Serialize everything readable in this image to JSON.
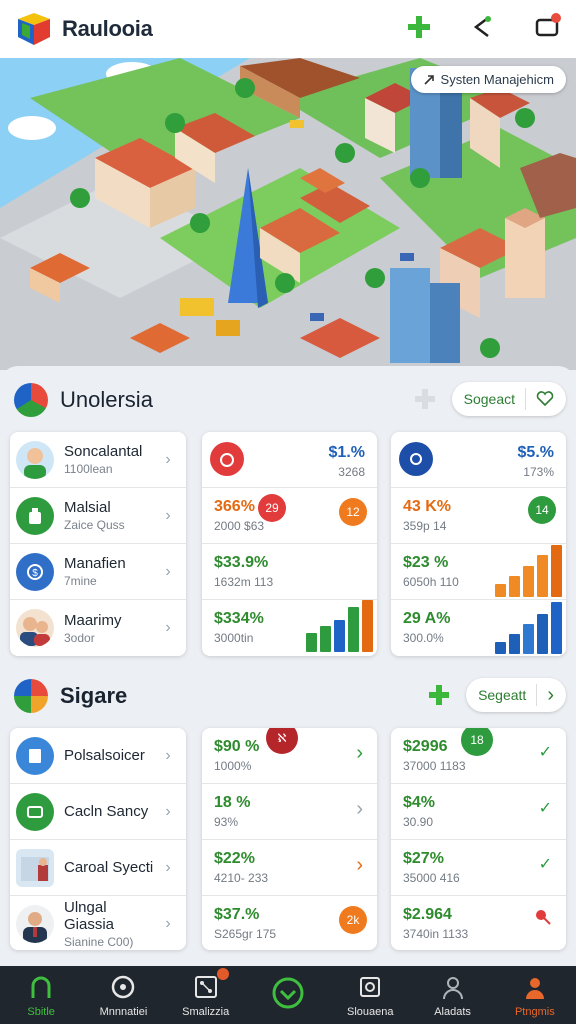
{
  "app": {
    "title": "Raulooia"
  },
  "hero": {
    "chip_label": "Systen Manajehicm"
  },
  "section1": {
    "title": "Unolersia",
    "action_label": "Sogeact",
    "list": [
      {
        "title": "Soncalantal",
        "sub": "1100lean"
      },
      {
        "title": "Malsial",
        "sub": "Zaice Quss"
      },
      {
        "title": "Manafien",
        "sub": "7mine"
      },
      {
        "title": "Maarimy",
        "sub": "3odor"
      }
    ],
    "col2": {
      "head_value": "$1.%",
      "head_sub": "3268",
      "rows": [
        {
          "value": "366%",
          "sub": "2000 $63",
          "badge": "29"
        },
        {
          "value": "$33.9%",
          "sub": "1632m 113"
        },
        {
          "value": "$334%",
          "sub": "3000tin"
        }
      ],
      "head_badge_extra": "12",
      "bars": [
        20,
        28,
        34,
        48,
        56
      ]
    },
    "col3": {
      "head_value": "$5.%",
      "head_sub": "173%",
      "rows": [
        {
          "value": "43 K%",
          "sub": "359p 14",
          "badge": "14"
        },
        {
          "value": "$23 %",
          "sub": "6050h 110"
        },
        {
          "value": "29 A%",
          "sub": "300.0%"
        }
      ],
      "bars_top": [
        14,
        22,
        32,
        44,
        54
      ],
      "bars_bottom": [
        12,
        20,
        30,
        40,
        52
      ]
    }
  },
  "section2": {
    "title": "Sigare",
    "action_label": "Segeatt",
    "list": [
      {
        "title": "Polsalsoicer",
        "sub": ""
      },
      {
        "title": "Cacln Sancy",
        "sub": ""
      },
      {
        "title": "Caroal Syecti",
        "sub": ""
      },
      {
        "title": "Ulngal Giassia",
        "sub": "Sianine C00)"
      }
    ],
    "col2": {
      "rows": [
        {
          "value": "$90 %",
          "sub": "1000%",
          "badge": "ℵ"
        },
        {
          "value": "18 %",
          "sub": "93%"
        },
        {
          "value": "$22%",
          "sub": "4210- 233"
        },
        {
          "value": "$37.%",
          "sub": "S265gr 175",
          "badge": "2k"
        }
      ]
    },
    "col3": {
      "rows": [
        {
          "value": "$2996",
          "sub": "37000 1183",
          "badge": "18"
        },
        {
          "value": "$4%",
          "sub": "30.90"
        },
        {
          "value": "$27%",
          "sub": "35000 416"
        },
        {
          "value": "$2.964",
          "sub": "3740in 1133"
        }
      ]
    }
  },
  "nav": {
    "items": [
      {
        "label": "Sbitle"
      },
      {
        "label": "Mnnnatiei"
      },
      {
        "label": "Smalizzia"
      },
      {
        "label": ""
      },
      {
        "label": "Slouaena"
      },
      {
        "label": "Aladats"
      },
      {
        "label": "Ptngmis"
      }
    ]
  }
}
